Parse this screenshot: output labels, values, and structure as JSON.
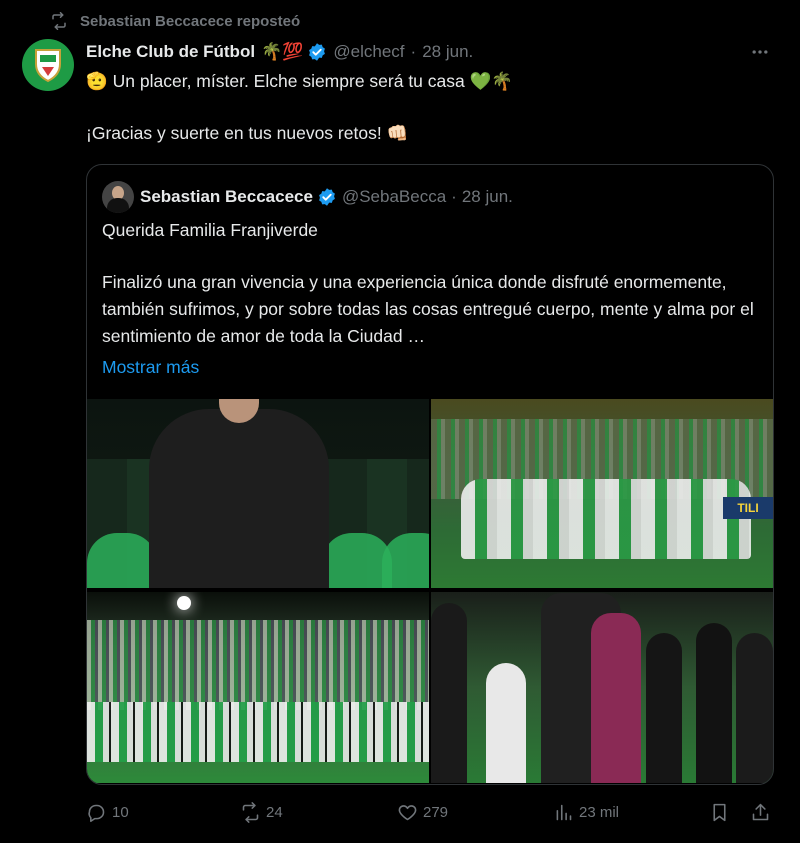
{
  "repost": {
    "text": "Sebastian Beccacece reposteó",
    "icon": "repost-icon"
  },
  "tweet": {
    "author_name": "Elche Club de Fútbol",
    "author_emojis": "🌴💯",
    "handle": "@elchecf",
    "separator": "·",
    "date": "28 jun.",
    "line1": "🫡 Un placer, míster. Elche siempre será tu casa 💚🌴",
    "line2": "¡Gracias y suerte en tus nuevos retos! 👊🏻",
    "avatar_color": "#1e9b45"
  },
  "quote": {
    "author_name": "Sebastian Beccacece",
    "handle": "@SebaBecca",
    "separator": "·",
    "date": "28 jun.",
    "greeting": "Querida Familia Franjiverde",
    "body": "Finalizó una gran vivencia y una experiencia única donde disfruté enormemente, también sufrimos, y por sobre todas las cosas entregué cuerpo, mente y alma por el sentimiento de amor de toda la Ciudad …",
    "show_more": "Mostrar más",
    "photo2_banner": "TILI"
  },
  "actions": {
    "replies": "10",
    "reposts": "24",
    "likes": "279",
    "views": "23 mil"
  },
  "colors": {
    "background": "#000000",
    "text": "#e7e9ea",
    "muted": "#71767b",
    "link": "#1d9bf0",
    "verified": "#1d9bf0",
    "border": "#2f3336"
  }
}
